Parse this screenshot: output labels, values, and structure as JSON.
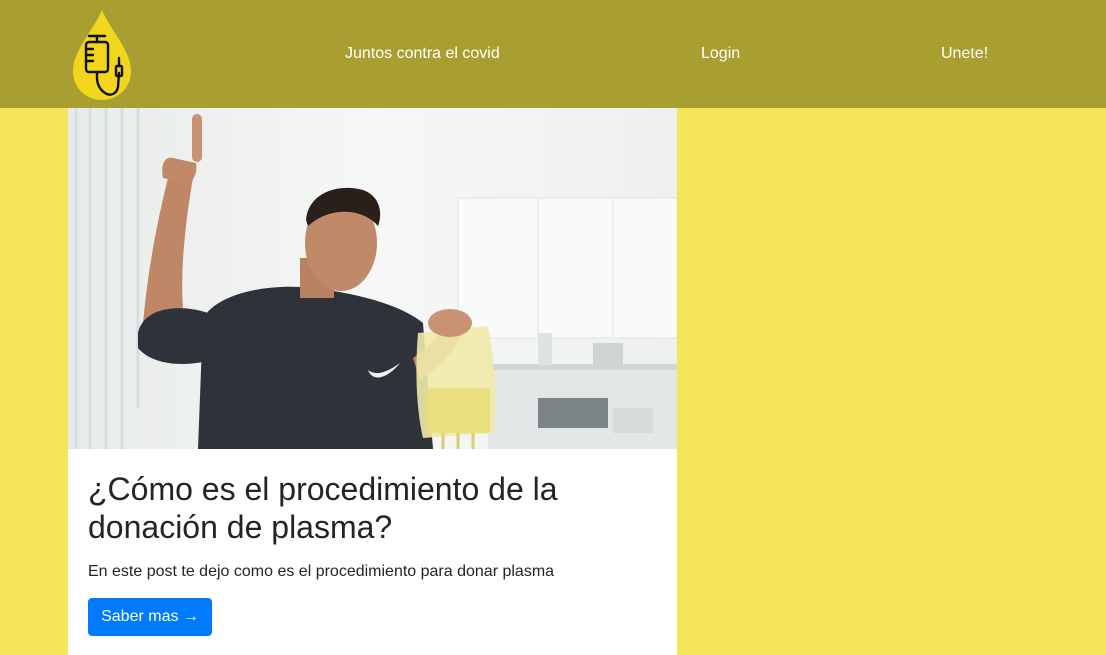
{
  "navbar": {
    "logo_icon": "plasma-drop-icon",
    "links": [
      {
        "label": "Juntos contra el covid"
      },
      {
        "label": "Login"
      },
      {
        "label": "Unete!"
      }
    ]
  },
  "card": {
    "image_alt": "plasma-donation-photo",
    "title": "¿Cómo es el procedimiento de la donación de plasma?",
    "text": "En este post te dejo como es el procedimiento para donar plasma",
    "button_label": "Saber mas →"
  },
  "colors": {
    "page_background": "#f5e55a",
    "navbar_background": "#a89f30",
    "logo_drop": "#f2d61e",
    "button": "#007bff"
  }
}
